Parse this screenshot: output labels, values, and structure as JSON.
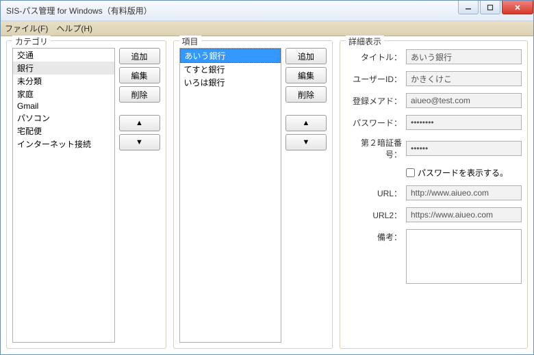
{
  "window": {
    "title": "SIS-パス管理 for Windows（有料版用）"
  },
  "menubar": {
    "file": "ファイル(F)",
    "help": "ヘルプ(H)"
  },
  "groups": {
    "category": "カテゴリ",
    "item": "項目",
    "detail": "詳細表示"
  },
  "buttons": {
    "add": "追加",
    "edit": "編集",
    "delete": "削除",
    "up": "▲",
    "down": "▼"
  },
  "categories": {
    "items": [
      "交通",
      "銀行",
      "未分類",
      "家庭",
      "Gmail",
      "パソコン",
      "宅配便",
      "インターネット接続"
    ],
    "selectedIndex": 1
  },
  "items": {
    "items": [
      "あいう銀行",
      "てすと銀行",
      "いろは銀行"
    ],
    "selectedIndex": 0
  },
  "details": {
    "labels": {
      "title": "タイトル：",
      "userId": "ユーザーID：",
      "email": "登録メアド：",
      "password": "パスワード：",
      "pin2": "第２暗証番号：",
      "showPassword": "パスワードを表示する。",
      "url": "URL：",
      "url2": "URL2：",
      "remarks": "備考："
    },
    "values": {
      "title": "あいう銀行",
      "userId": "かきくけこ",
      "email": "aiueo@test.com",
      "password": "••••••••",
      "pin2": "••••••",
      "url": "http://www.aiueo.com",
      "url2": "https://www.aiueo.com",
      "remarks": ""
    },
    "showPasswordChecked": false
  }
}
